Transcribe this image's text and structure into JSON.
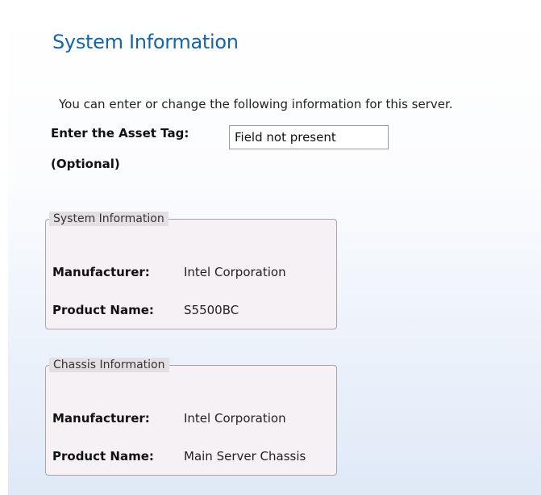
{
  "page": {
    "title": "System Information",
    "intro": "You can enter or change the following information for this server."
  },
  "asset_tag": {
    "label": "Enter the Asset Tag:",
    "optional": "(Optional)",
    "value": "Field not present"
  },
  "system_info": {
    "legend": "System Information",
    "rows": [
      {
        "label": "Manufacturer:",
        "value": "Intel Corporation"
      },
      {
        "label": "Product Name:",
        "value": "S5500BC"
      }
    ]
  },
  "chassis_info": {
    "legend": "Chassis Information",
    "rows": [
      {
        "label": "Manufacturer:",
        "value": "Intel Corporation"
      },
      {
        "label": "Product Name:",
        "value": "Main Server Chassis"
      }
    ]
  },
  "colors": {
    "title": "#1565a8",
    "group_background": "#f6f1f4",
    "legend_background": "#e4dfe2",
    "panel_gradient_bottom": "#dfe9f7"
  }
}
